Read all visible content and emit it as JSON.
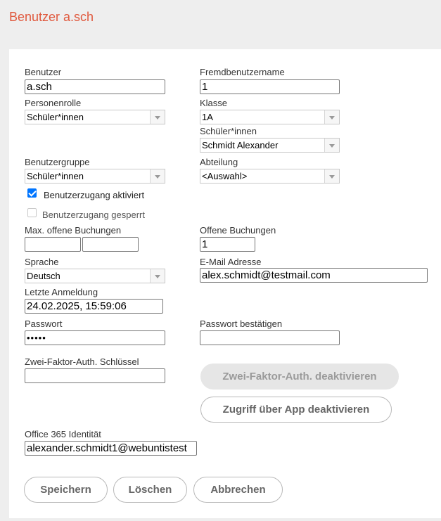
{
  "title": "Benutzer a.sch",
  "fields": {
    "benutzer": {
      "label": "Benutzer",
      "value": "a.sch"
    },
    "fremdbenutzername": {
      "label": "Fremdbenutzername",
      "value": "1"
    },
    "personenrolle": {
      "label": "Personenrolle",
      "value": "Schüler*innen"
    },
    "klasse": {
      "label": "Klasse",
      "value": "1A"
    },
    "schueler": {
      "label": "Schüler*innen",
      "value": "Schmidt Alexander"
    },
    "benutzergruppe": {
      "label": "Benutzergruppe",
      "value": "Schüler*innen"
    },
    "abteilung": {
      "label": "Abteilung",
      "value": "<Auswahl>"
    },
    "zugang_aktiviert": {
      "label": "Benutzerzugang aktiviert",
      "checked": true
    },
    "zugang_gesperrt": {
      "label": "Benutzerzugang gesperrt",
      "checked": false
    },
    "max_buchungen": {
      "label": "Max. offene Buchungen",
      "value1": "",
      "value2": ""
    },
    "offene_buchungen": {
      "label": "Offene Buchungen",
      "value": "1"
    },
    "sprache": {
      "label": "Sprache",
      "value": "Deutsch"
    },
    "email": {
      "label": "E-Mail Adresse",
      "value": "alex.schmidt@testmail.com"
    },
    "letzte_anmeldung": {
      "label": "Letzte Anmeldung",
      "value": "24.02.2025, 15:59:06"
    },
    "passwort": {
      "label": "Passwort",
      "value": "•••••"
    },
    "passwort_bestaetigen": {
      "label": "Passwort bestätigen",
      "value": ""
    },
    "zwei_faktor": {
      "label": "Zwei-Faktor-Auth. Schlüssel",
      "value": ""
    },
    "office365": {
      "label": "Office 365 Identität",
      "value": "alexander.schmidt1@webuntistest"
    }
  },
  "buttons": {
    "zwei_faktor_deaktivieren": "Zwei-Faktor-Auth. deaktivieren",
    "app_deaktivieren": "Zugriff über App deaktivieren",
    "speichern": "Speichern",
    "loeschen": "Löschen",
    "abbrechen": "Abbrechen"
  }
}
